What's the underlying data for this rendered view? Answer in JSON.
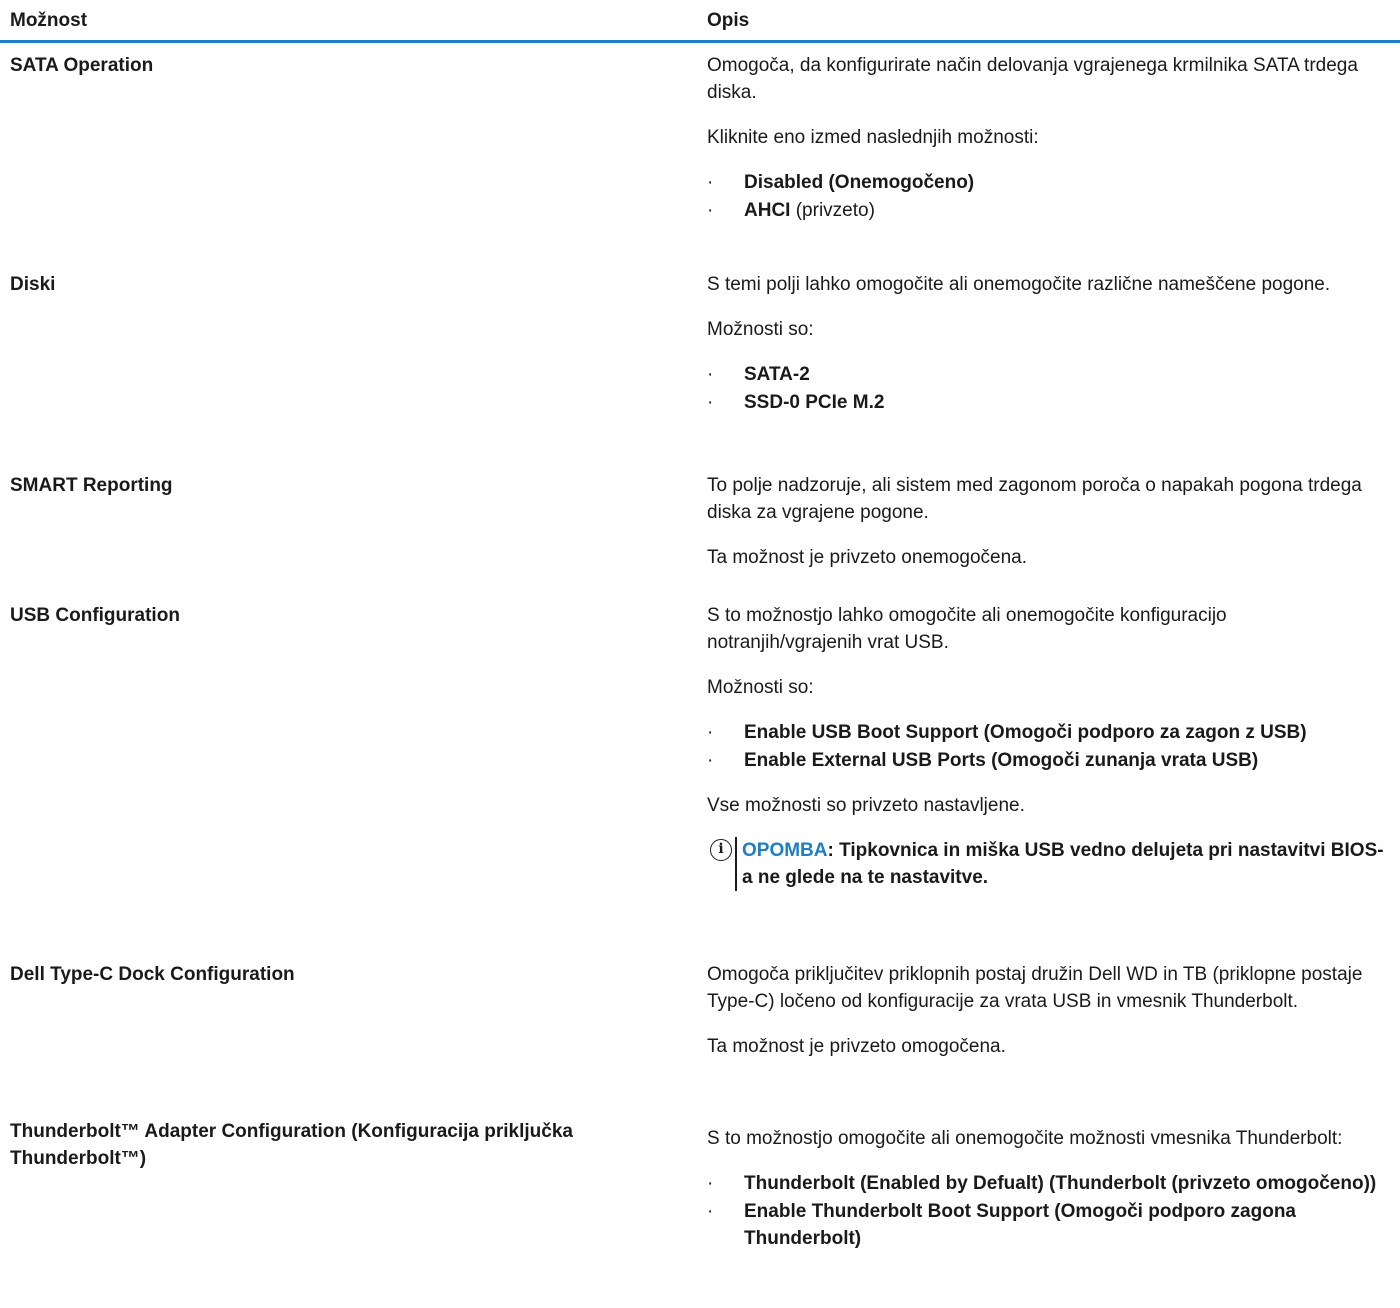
{
  "header": {
    "col_option": "Možnost",
    "col_desc": "Opis"
  },
  "rows": [
    {
      "option": "SATA Operation",
      "paras": [
        "Omogoča, da konfigurirate način delovanja vgrajenega krmilnika SATA trdega diska.",
        "Kliknite eno izmed naslednjih možnosti:"
      ],
      "bullets": [
        {
          "b": "Disabled (Onemogočeno)",
          "n": ""
        },
        {
          "b": "AHCI",
          "n": " (privzeto)"
        }
      ]
    },
    {
      "option": "Diski",
      "paras": [
        "S temi polji lahko omogočite ali onemogočite različne nameščene pogone.",
        "Možnosti so:"
      ],
      "bullets": [
        {
          "b": "SATA-2",
          "n": ""
        },
        {
          "b": "SSD-0 PCIe M.2",
          "n": ""
        }
      ]
    },
    {
      "option": "SMART Reporting",
      "paras": [
        "To polje nadzoruje, ali sistem med zagonom poroča o napakah pogona trdega diska za vgrajene pogone.",
        "Ta možnost je privzeto onemogočena."
      ]
    },
    {
      "option": "USB Configuration",
      "paras": [
        "S to možnostjo lahko omogočite ali onemogočite konfiguracijo notranjih/vgrajenih vrat USB.",
        "Možnosti so:"
      ],
      "bullets": [
        {
          "b": "Enable USB Boot Support (Omogoči podporo za zagon z USB)",
          "n": ""
        },
        {
          "b": "Enable External USB Ports (Omogoči zunanja vrata USB)",
          "n": ""
        }
      ],
      "after": "Vse možnosti so privzeto nastavljene.",
      "note": {
        "label": "OPOMBA",
        "text": ": Tipkovnica in miška USB vedno delujeta pri nastavitvi BIOS-a ne glede na te nastavitve."
      }
    },
    {
      "option": "Dell Type-C Dock Configuration",
      "paras": [
        "Omogoča priključitev priklopnih postaj družin Dell WD in TB (priklopne postaje Type-C) ločeno od konfiguracije za vrata USB in vmesnik Thunderbolt.",
        "Ta možnost je privzeto omogočena."
      ]
    },
    {
      "option": "Thunderbolt™ Adapter Configuration (Konfiguracija priključka Thunderbolt™)",
      "paras": [
        "S to možnostjo omogočite ali onemogočite možnosti vmesnika Thunderbolt:"
      ],
      "bullets": [
        {
          "b": "Thunderbolt (Enabled by Defualt) (Thunderbolt (privzeto omogočeno))",
          "n": ""
        },
        {
          "b": "Enable Thunderbolt Boot Support (Omogoči podporo zagona Thunderbolt)",
          "n": ""
        }
      ]
    }
  ]
}
